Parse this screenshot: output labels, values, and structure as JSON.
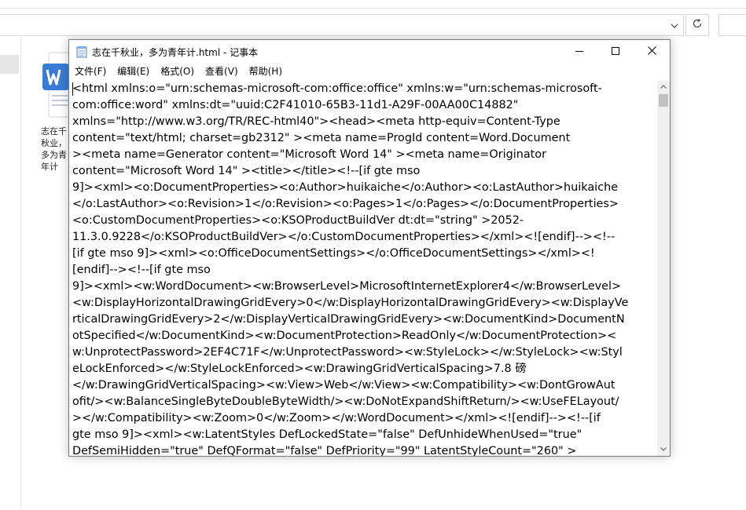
{
  "explorer": {
    "file_label": "志在千秋业，多为青年计"
  },
  "icons": {
    "address_dropdown": "chevron-down-icon",
    "refresh": "refresh-icon",
    "file": "wps-writer-file-icon",
    "notepad": "notepad-icon",
    "minimize": "minimize-icon",
    "maximize": "maximize-icon",
    "close": "close-icon"
  },
  "notepad": {
    "title": "志在千秋业，多为青年计.html - 记事本",
    "menu": [
      "文件(F)",
      "编辑(E)",
      "格式(O)",
      "查看(V)",
      "帮助(H)"
    ],
    "lines": [
      "<html xmlns:o=\"urn:schemas-microsoft-com:office:office\" xmlns:w=\"urn:schemas-microsoft-",
      "com:office:word\" xmlns:dt=\"uuid:C2F41010-65B3-11d1-A29F-00AA00C14882\"",
      "xmlns=\"http://www.w3.org/TR/REC-html40\"><head><meta http-equiv=Content-Type",
      "content=\"text/html; charset=gb2312\" ><meta name=ProgId  content=Word.Document",
      "><meta name=Generator  content=\"Microsoft Word 14\" ><meta name=Originator",
      "content=\"Microsoft Word 14\" ><title></title><!--[if gte mso",
      "9]><xml><o:DocumentProperties><o:Author>huikaiche</o:Author><o:LastAuthor>huikaiche",
      "</o:LastAuthor><o:Revision>1</o:Revision><o:Pages>1</o:Pages></o:DocumentProperties>",
      "<o:CustomDocumentProperties><o:KSOProductBuildVer dt:dt=\"string\" >2052-",
      "11.3.0.9228</o:KSOProductBuildVer></o:CustomDocumentProperties></xml><![endif]--><!--",
      "[if gte mso 9]><xml><o:OfficeDocumentSettings></o:OfficeDocumentSettings></xml><!",
      "[endif]--><!--[if gte mso",
      "9]><xml><w:WordDocument><w:BrowserLevel>MicrosoftInternetExplorer4</w:BrowserLevel>",
      "<w:DisplayHorizontalDrawingGridEvery>0</w:DisplayHorizontalDrawingGridEvery><w:DisplayVe",
      "rticalDrawingGridEvery>2</w:DisplayVerticalDrawingGridEvery><w:DocumentKind>DocumentN",
      "otSpecified</w:DocumentKind><w:DocumentProtection>ReadOnly</w:DocumentProtection><",
      "w:UnprotectPassword>2EF4C71F</w:UnprotectPassword><w:StyleLock></w:StyleLock><w:Styl",
      "eLockEnforced></w:StyleLockEnforced><w:DrawingGridVerticalSpacing>7.8 磅",
      "</w:DrawingGridVerticalSpacing><w:View>Web</w:View><w:Compatibility><w:DontGrowAut",
      "ofit/><w:BalanceSingleByteDoubleByteWidth/><w:DoNotExpandShiftReturn/><w:UseFELayout/",
      "></w:Compatibility><w:Zoom>0</w:Zoom></w:WordDocument></xml><![endif]--><!--[if",
      "gte mso 9]><xml><w:LatentStyles DefLockedState=\"false\"  DefUnhideWhenUsed=\"true\"",
      "DefSemiHidden=\"true\"  DefQFormat=\"false\"  DefPriority=\"99\"  LatentStyleCount=\"260\" >"
    ]
  }
}
